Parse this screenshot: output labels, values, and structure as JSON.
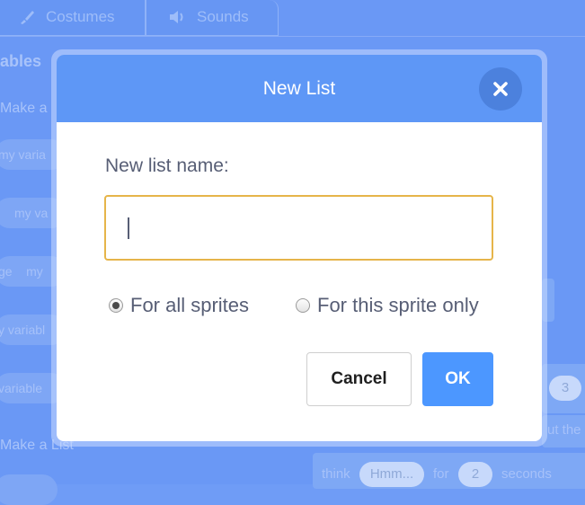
{
  "background": {
    "tabs": [
      {
        "label": "Costumes",
        "icon": "brush-icon"
      },
      {
        "label": "Sounds",
        "icon": "speaker-icon"
      }
    ],
    "heading": "ables",
    "make_variable": "Make a",
    "variable_pills": [
      "my varia",
      "my va",
      "my",
      "y variabl",
      "variable"
    ],
    "set_block_prefix": "ge",
    "make_list": "Make a List",
    "think_block": {
      "word": "think",
      "message": "Hmm...",
      "for": "for",
      "seconds_value": "2",
      "seconds": "seconds"
    },
    "number_oval": "3",
    "other_text": "ut the"
  },
  "dialog": {
    "title": "New List",
    "close_icon": "close-icon",
    "field_label": "New list name:",
    "input_value": "",
    "input_placeholder": "",
    "radio_options": [
      {
        "label": "For all sprites",
        "checked": true
      },
      {
        "label": "For this sprite only",
        "checked": false
      }
    ],
    "cancel_label": "Cancel",
    "ok_label": "OK",
    "colors": {
      "header": "#5e97f6",
      "ok_button": "#4c97ff",
      "input_focus_border": "#e6b54a",
      "overlay": "#6f9cf6"
    }
  }
}
